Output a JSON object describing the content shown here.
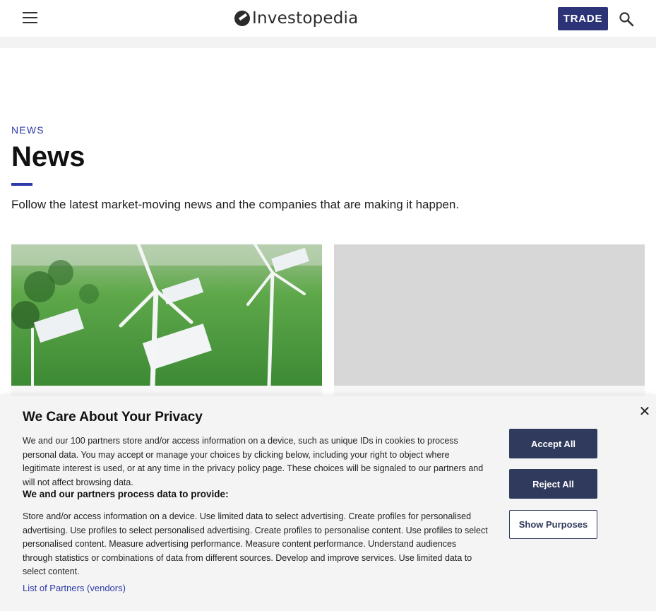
{
  "header": {
    "logo_text": "Investopedia",
    "trade_label": "TRADE",
    "menu_icon": "hamburger-menu-icon",
    "search_icon": "search-icon"
  },
  "main": {
    "breadcrumb": "NEWS",
    "title": "News",
    "intro": "Follow the latest market-moving news and the companies that are making it happen.",
    "cards": [
      {
        "image": "wind-turbines-photo"
      },
      {
        "image": "placeholder-image"
      }
    ]
  },
  "consent": {
    "title": "We Care About Your Privacy",
    "body": "We and our 100 partners store and/or access information on a device, such as unique IDs in cookies to process personal data. You may accept or manage your choices by clicking below, including your right to object where legitimate interest is used, or at any time in the privacy policy page. These choices will be signaled to our partners and will not affect browsing data.",
    "subtitle": "We and our partners process data to provide:",
    "purposes": "Store and/or access information on a device. Use limited data to select advertising. Create profiles for personalised advertising. Use profiles to select personalised advertising. Create profiles to personalise content. Use profiles to select personalised content. Measure advertising performance. Measure content performance. Understand audiences through statistics or combinations of data from different sources. Develop and improve services. Use limited data to select content.",
    "partners_link": "List of Partners (vendors)",
    "accept_label": "Accept All",
    "reject_label": "Reject All",
    "show_purposes_label": "Show Purposes",
    "close_icon": "close-icon"
  },
  "colors": {
    "brand_blue": "#2c3477",
    "accent_blue": "#2c3aa8",
    "consent_button": "#2f3a5c"
  }
}
